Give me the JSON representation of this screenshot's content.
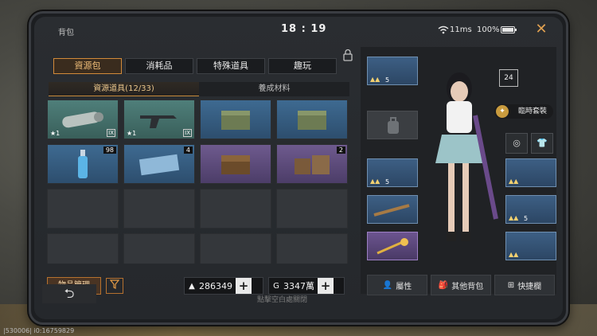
{
  "status": {
    "title": "背包",
    "clock": "18 : 19",
    "latency": "11ms",
    "battery": "100%"
  },
  "categories": [
    "資源包",
    "消耗品",
    "特殊道具",
    "趣玩"
  ],
  "subtabs": [
    "資源道具(12/33)",
    "養成材料"
  ],
  "items": [
    {
      "badge": "",
      "star": "★1",
      "roman": "IX"
    },
    {
      "badge": "",
      "star": "★1",
      "roman": "IX"
    },
    {
      "badge": "",
      "star": "",
      "roman": ""
    },
    {
      "badge": "",
      "star": "",
      "roman": ""
    },
    {
      "badge": "98",
      "star": "",
      "roman": ""
    },
    {
      "badge": "4",
      "star": "",
      "roman": ""
    },
    {
      "badge": "",
      "star": "",
      "roman": ""
    },
    {
      "badge": "2",
      "star": "",
      "roman": ""
    }
  ],
  "bottom": {
    "manage": "物品管理",
    "currency1": "286349",
    "currency2": "3347萬"
  },
  "right": {
    "level": "24",
    "outfit": "臨時套裝",
    "equip_count_1": "5",
    "equip_count_2": "5",
    "equip_count_3": "5",
    "btn_attr": "屬性",
    "btn_other": "其他背包",
    "btn_quick": "快捷欄"
  },
  "hint": "點擊空白處關閉",
  "footer_id": "|530006| i0:16759829",
  "colors": {
    "accent": "#d28a3a",
    "panel": "#25282c"
  }
}
